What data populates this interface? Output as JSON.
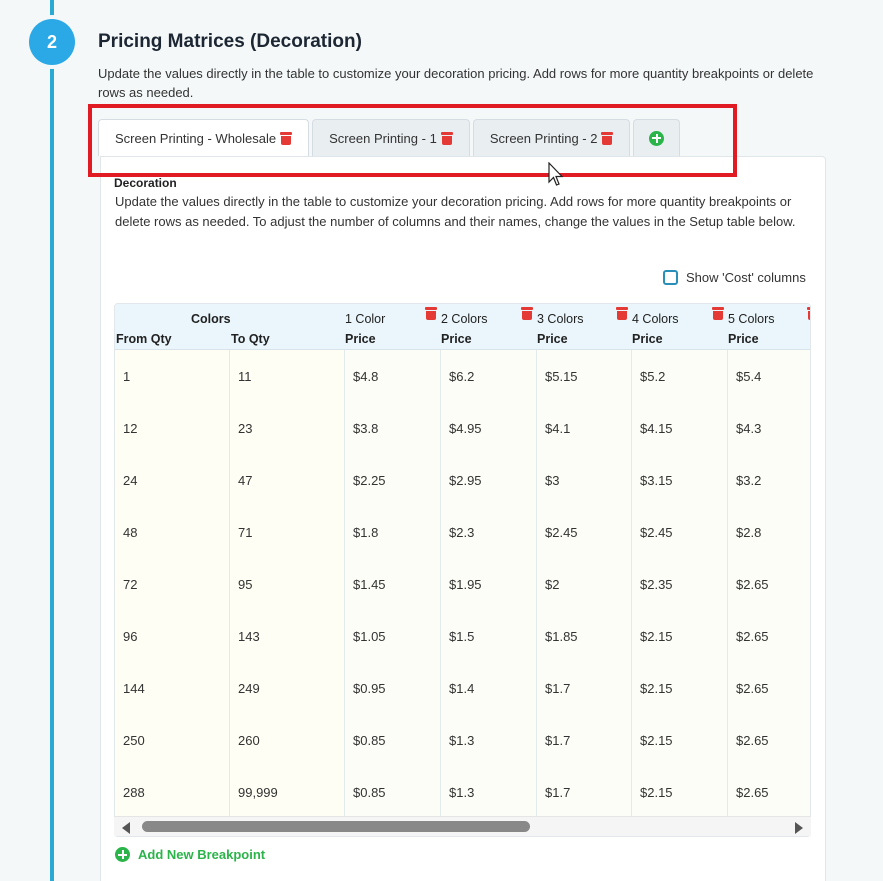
{
  "step": {
    "number": "2"
  },
  "section": {
    "title": "Pricing Matrices (Decoration)",
    "description": "Update the values directly in the table to customize your decoration pricing. Add rows for more quantity breakpoints or delete rows as needed."
  },
  "tabs": [
    {
      "label": "Screen Printing - Wholesale"
    },
    {
      "label": "Screen Printing - 1"
    },
    {
      "label": "Screen Printing - 2"
    }
  ],
  "panel": {
    "label": "Decoration",
    "description": "Update the values directly in the table to customize your decoration pricing. Add rows for more quantity breakpoints or delete rows as needed. To adjust the number of columns and their names, change the values in the Setup table below.",
    "show_cost_label": "Show 'Cost' columns"
  },
  "table": {
    "group_header": "Colors",
    "from_qty": "From Qty",
    "to_qty": "To Qty",
    "color_columns": [
      {
        "name": "1 Color",
        "sub": "Price"
      },
      {
        "name": "2 Colors",
        "sub": "Price"
      },
      {
        "name": "3 Colors",
        "sub": "Price"
      },
      {
        "name": "4 Colors",
        "sub": "Price"
      },
      {
        "name": "5 Colors",
        "sub": "Price"
      }
    ],
    "rows": [
      [
        "1",
        "11",
        "$4.8",
        "$6.2",
        "$5.15",
        "$5.2",
        "$5.4"
      ],
      [
        "12",
        "23",
        "$3.8",
        "$4.95",
        "$4.1",
        "$4.15",
        "$4.3"
      ],
      [
        "24",
        "47",
        "$2.25",
        "$2.95",
        "$3",
        "$3.15",
        "$3.2"
      ],
      [
        "48",
        "71",
        "$1.8",
        "$2.3",
        "$2.45",
        "$2.45",
        "$2.8"
      ],
      [
        "72",
        "95",
        "$1.45",
        "$1.95",
        "$2",
        "$2.35",
        "$2.65"
      ],
      [
        "96",
        "143",
        "$1.05",
        "$1.5",
        "$1.85",
        "$2.15",
        "$2.65"
      ],
      [
        "144",
        "249",
        "$0.95",
        "$1.4",
        "$1.7",
        "$2.15",
        "$2.65"
      ],
      [
        "250",
        "260",
        "$0.85",
        "$1.3",
        "$1.7",
        "$2.15",
        "$2.65"
      ],
      [
        "288",
        "99,999",
        "$0.85",
        "$1.3",
        "$1.7",
        "$2.15",
        "$2.65"
      ]
    ]
  },
  "add_breakpoint_label": "Add New Breakpoint",
  "colors": {
    "accent": "#2aa9e6",
    "danger": "#e53935",
    "success": "#2bb44a",
    "highlight": "#e01b24"
  }
}
